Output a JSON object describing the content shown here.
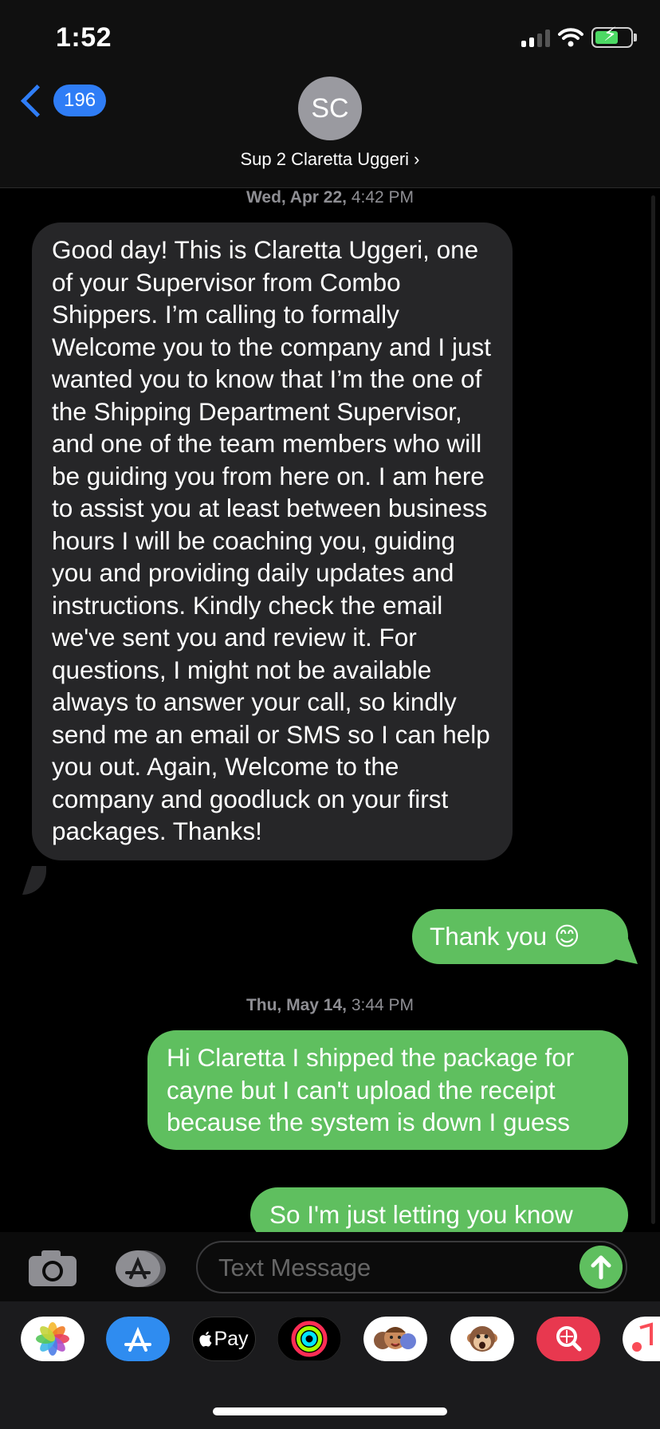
{
  "status_bar": {
    "time": "1:52"
  },
  "header": {
    "back_count": "196",
    "avatar_initials": "SC",
    "contact_name": "Sup 2 Claretta Uggeri ›"
  },
  "thread": {
    "timestamp1_day": "Wed, Apr 22,",
    "timestamp1_time": " 4:42 PM",
    "incoming_message": "Good day! This is Claretta Uggeri, one of your Supervisor from Combo Shippers. I’m calling to formally Welcome you to the company and I just wanted you to know that I’m the one of the Shipping Department Supervisor, and one of the team members who will be guiding you from here on. I am here to assist you at least between business hours I will be coaching you, guiding you and providing daily updates and instructions. Kindly check the email we've sent you and review it. For questions, I might not be available always to answer your call, so kindly send me an email or SMS so I can help you out. Again, Welcome to the company and goodluck on your first packages. Thanks!",
    "reply1": "Thank you 😊",
    "timestamp2_day": "Thu, May 14,",
    "timestamp2_time": " 3:44 PM",
    "reply2": "Hi Claretta I shipped the package for cayne but I can't upload the receipt because the system is down I guess",
    "reply3": "So I'm just letting you know"
  },
  "composer": {
    "placeholder": "Text Message"
  },
  "app_strip": {
    "apple_pay_label": "Pay",
    "apps": [
      "photos-icon",
      "app-store-icon",
      "apple-pay-icon",
      "activity-icon",
      "memoji-icon",
      "animoji-icon",
      "image-search-icon",
      "music-icon"
    ]
  },
  "colors": {
    "accent": "#2f7df6",
    "sent_bubble": "#5fbf5f",
    "received_bubble": "#262628"
  }
}
